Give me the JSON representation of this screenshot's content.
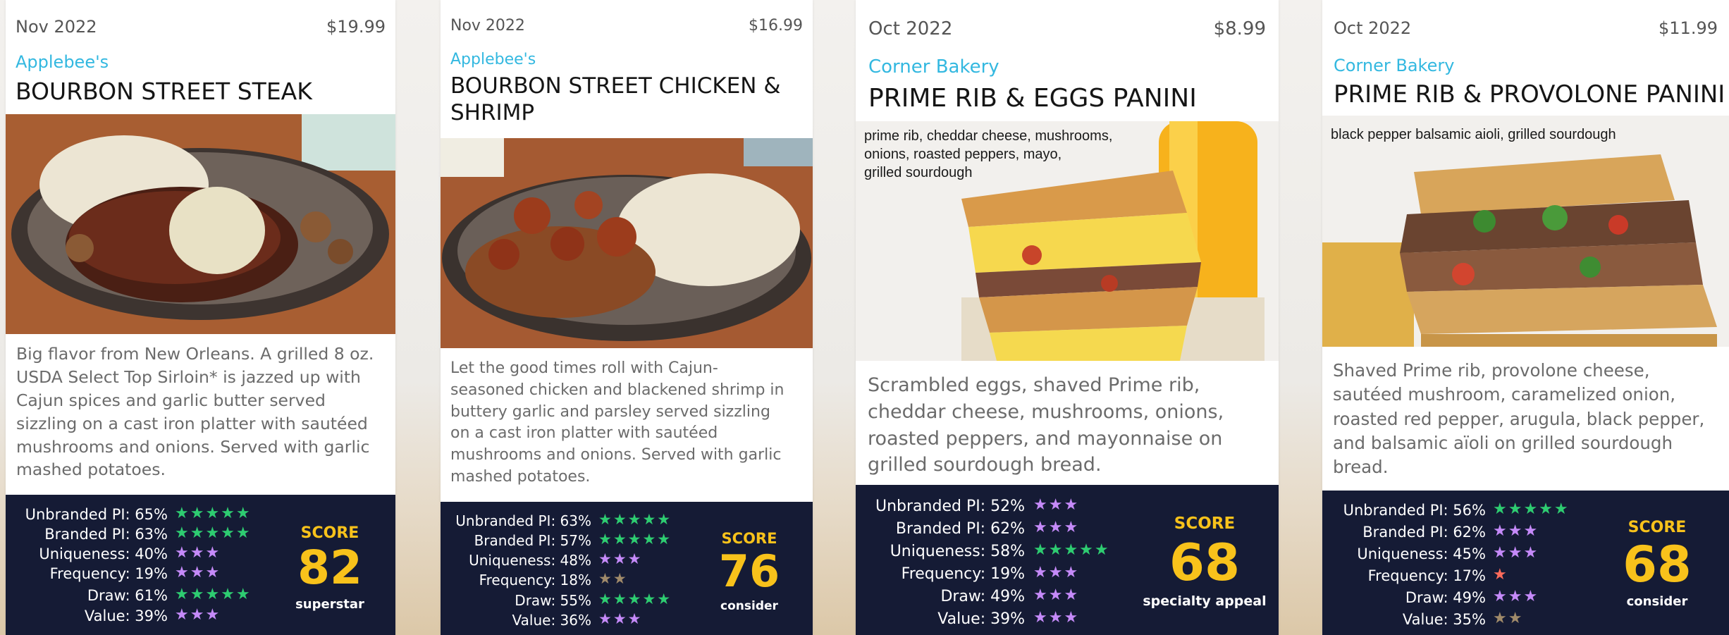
{
  "star_colors": {
    "green": "#2ecc71",
    "purple": "#c58af9",
    "tan": "#a08a6a",
    "coral": "#ff6b5b"
  },
  "cards": [
    {
      "date": "Nov 2022",
      "price": "$19.99",
      "brand": "Applebee's",
      "title": "BOURBON STREET STEAK",
      "photo": "steak with garlic butter, mashed potatoes and mushrooms on cast iron platter",
      "photo_text": "",
      "description": "Big flavor from New Orleans. A grilled 8 oz.\nUSDA Select Top Sirloin* is jazzed up with\nCajun spices and garlic butter served\nsizzling on a cast iron platter with sautéed\nmushrooms and onions. Served with garlic\nmashed potatoes.",
      "metrics": [
        {
          "label": "Unbranded PI: 65%",
          "stars": "★★★★★",
          "color": "green"
        },
        {
          "label": "Branded PI: 63%",
          "stars": "★★★★★",
          "color": "green"
        },
        {
          "label": "Uniqueness: 40%",
          "stars": "★★★",
          "color": "purple"
        },
        {
          "label": "Frequency: 19%",
          "stars": "★★★",
          "color": "purple"
        },
        {
          "label": "Draw: 61%",
          "stars": "★★★★★",
          "color": "green"
        },
        {
          "label": "Value: 39%",
          "stars": "★★★",
          "color": "purple"
        }
      ],
      "score_label": "SCORE",
      "score": "82",
      "tier": "superstar"
    },
    {
      "date": "Nov 2022",
      "price": "$16.99",
      "brand": "Applebee's",
      "title": "BOURBON STREET CHICKEN &\nSHRIMP",
      "photo": "cajun chicken and blackened shrimp with mashed potatoes on cast iron platter",
      "photo_text": "",
      "description": "Let the good times roll with Cajun-\nseasoned chicken and blackened shrimp in\nbuttery garlic and parsley served sizzling\non a cast iron platter with sautéed\nmushrooms and onions. Served with garlic\nmashed potatoes.",
      "metrics": [
        {
          "label": "Unbranded PI: 63%",
          "stars": "★★★★★",
          "color": "green"
        },
        {
          "label": "Branded PI: 57%",
          "stars": "★★★★★",
          "color": "green"
        },
        {
          "label": "Uniqueness: 48%",
          "stars": "★★★",
          "color": "purple"
        },
        {
          "label": "Frequency: 18%",
          "stars": "★★",
          "color": "tan"
        },
        {
          "label": "Draw: 55%",
          "stars": "★★★★★",
          "color": "green"
        },
        {
          "label": "Value: 36%",
          "stars": "★★★",
          "color": "purple"
        }
      ],
      "score_label": "SCORE",
      "score": "76",
      "tier": "consider"
    },
    {
      "date": "Oct 2022",
      "price": "$8.99",
      "brand": "Corner Bakery",
      "title": "PRIME RIB & EGGS PANINI",
      "photo": "prime rib and egg panini with orange juice",
      "photo_text": "prime rib, cheddar cheese, mushrooms,\nonions, roasted peppers, mayo,\ngrilled sourdough",
      "description": "Scrambled eggs, shaved Prime rib,\ncheddar cheese, mushrooms, onions,\nroasted peppers, and mayonnaise on\ngrilled sourdough bread.",
      "metrics": [
        {
          "label": "Unbranded PI: 52%",
          "stars": "★★★",
          "color": "purple"
        },
        {
          "label": "Branded PI: 62%",
          "stars": "★★★",
          "color": "purple"
        },
        {
          "label": "Uniqueness: 58%",
          "stars": "★★★★★",
          "color": "green"
        },
        {
          "label": "Frequency: 19%",
          "stars": "★★★",
          "color": "purple"
        },
        {
          "label": "Draw: 49%",
          "stars": "★★★",
          "color": "purple"
        },
        {
          "label": "Value: 39%",
          "stars": "★★★",
          "color": "purple"
        }
      ],
      "score_label": "SCORE",
      "score": "68",
      "tier": "specialty appeal"
    },
    {
      "date": "Oct 2022",
      "price": "$11.99",
      "brand": "Corner Bakery",
      "title": "PRIME RIB & PROVOLONE PANINI",
      "photo": "prime rib and provolone panini with arugula and roasted peppers",
      "photo_text": "black pepper balsamic aioli, grilled sourdough",
      "description": "Shaved Prime rib, provolone cheese,\nsautéed mushroom, caramelized onion,\nroasted red pepper, arugula, black pepper,\nand balsamic aïoli on grilled sourdough\nbread.",
      "metrics": [
        {
          "label": "Unbranded PI: 56%",
          "stars": "★★★★★",
          "color": "green"
        },
        {
          "label": "Branded PI: 62%",
          "stars": "★★★",
          "color": "purple"
        },
        {
          "label": "Uniqueness: 45%",
          "stars": "★★★",
          "color": "purple"
        },
        {
          "label": "Frequency: 17%",
          "stars": "★",
          "color": "coral"
        },
        {
          "label": "Draw: 49%",
          "stars": "★★★",
          "color": "purple"
        },
        {
          "label": "Value: 35%",
          "stars": "★★",
          "color": "tan"
        }
      ],
      "score_label": "SCORE",
      "score": "68",
      "tier": "consider"
    }
  ]
}
